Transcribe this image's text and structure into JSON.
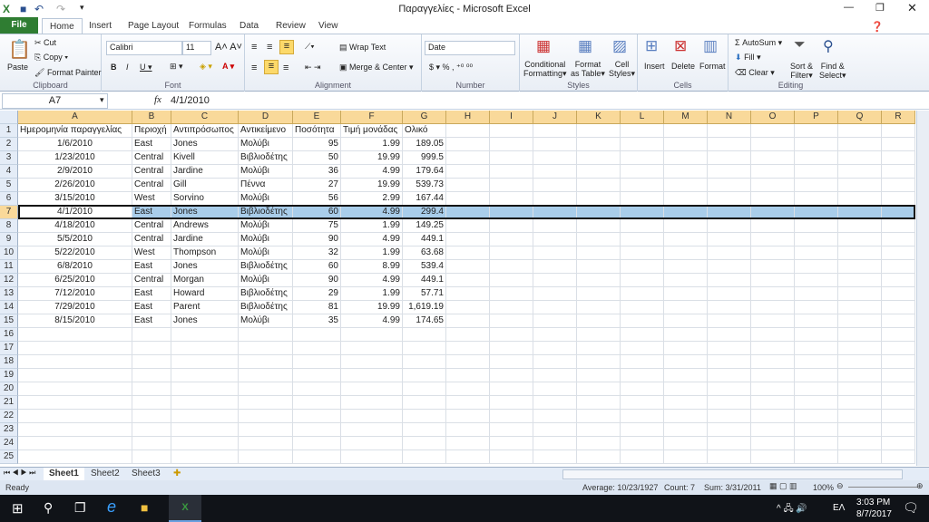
{
  "window": {
    "title": "Παραγγελίες - Microsoft Excel"
  },
  "ribbon_tabs": [
    "File",
    "Home",
    "Insert",
    "Page Layout",
    "Formulas",
    "Data",
    "Review",
    "View"
  ],
  "clipboard": {
    "paste": "Paste",
    "cut": "Cut",
    "copy": "Copy",
    "format_painter": "Format Painter",
    "label": "Clipboard"
  },
  "font": {
    "name": "Calibri",
    "size": "11",
    "label": "Font"
  },
  "alignment": {
    "wrap": "Wrap Text",
    "merge": "Merge & Center",
    "label": "Alignment"
  },
  "number": {
    "format": "Date",
    "label": "Number"
  },
  "styles": {
    "cond1": "Conditional",
    "cond2": "Formatting",
    "fmt1": "Format",
    "fmt2": "as Table",
    "cell1": "Cell",
    "cell2": "Styles",
    "label": "Styles"
  },
  "cells": {
    "insert": "Insert",
    "delete": "Delete",
    "format": "Format",
    "label": "Cells"
  },
  "editing": {
    "autosum": "AutoSum",
    "fill": "Fill",
    "clear": "Clear",
    "sort1": "Sort &",
    "sort2": "Filter",
    "find1": "Find &",
    "find2": "Select",
    "label": "Editing"
  },
  "formula_bar": {
    "name_box": "A7",
    "fx": "fx",
    "value": "4/1/2010"
  },
  "columns": [
    "A",
    "B",
    "C",
    "D",
    "E",
    "F",
    "G",
    "H",
    "I",
    "J",
    "K",
    "L",
    "M",
    "N",
    "O",
    "P",
    "Q",
    "R"
  ],
  "headers": [
    "Ημερομηνία παραγγελίας",
    "Περιοχή",
    "Αντιπρόσωπος",
    "Αντικείμενο",
    "Ποσότητα",
    "Τιμή μονάδας",
    "Ολικό"
  ],
  "rows": [
    [
      "1/6/2010",
      "East",
      "Jones",
      "Μολύβι",
      "95",
      "1.99",
      "189.05"
    ],
    [
      "1/23/2010",
      "Central",
      "Kivell",
      "Βιβλιοδέτης",
      "50",
      "19.99",
      "999.5"
    ],
    [
      "2/9/2010",
      "Central",
      "Jardine",
      "Μολύβι",
      "36",
      "4.99",
      "179.64"
    ],
    [
      "2/26/2010",
      "Central",
      "Gill",
      "Πέννα",
      "27",
      "19.99",
      "539.73"
    ],
    [
      "3/15/2010",
      "West",
      "Sorvino",
      "Μολύβι",
      "56",
      "2.99",
      "167.44"
    ],
    [
      "4/1/2010",
      "East",
      "Jones",
      "Βιβλιοδέτης",
      "60",
      "4.99",
      "299.4"
    ],
    [
      "4/18/2010",
      "Central",
      "Andrews",
      "Μολύβι",
      "75",
      "1.99",
      "149.25"
    ],
    [
      "5/5/2010",
      "Central",
      "Jardine",
      "Μολύβι",
      "90",
      "4.99",
      "449.1"
    ],
    [
      "5/22/2010",
      "West",
      "Thompson",
      "Μολύβι",
      "32",
      "1.99",
      "63.68"
    ],
    [
      "6/8/2010",
      "East",
      "Jones",
      "Βιβλιοδέτης",
      "60",
      "8.99",
      "539.4"
    ],
    [
      "6/25/2010",
      "Central",
      "Morgan",
      "Μολύβι",
      "90",
      "4.99",
      "449.1"
    ],
    [
      "7/12/2010",
      "East",
      "Howard",
      "Βιβλιοδέτης",
      "29",
      "1.99",
      "57.71"
    ],
    [
      "7/29/2010",
      "East",
      "Parent",
      "Βιβλιοδέτης",
      "81",
      "19.99",
      "1,619.19"
    ],
    [
      "8/15/2010",
      "East",
      "Jones",
      "Μολύβι",
      "35",
      "4.99",
      "174.65"
    ]
  ],
  "selected_row": 7,
  "sheets": [
    "Sheet1",
    "Sheet2",
    "Sheet3"
  ],
  "status": {
    "ready": "Ready",
    "average": "Average: 10/23/1927",
    "count": "Count: 7",
    "sum": "Sum: 3/31/2011",
    "zoom": "100%"
  },
  "taskbar": {
    "time": "3:03 PM",
    "date": "8/7/2017",
    "lang": "ΕΛ"
  },
  "colors": {
    "accent": "#2f7d32",
    "selection": "#a9cdea",
    "header_highlight": "#f9d99a"
  }
}
